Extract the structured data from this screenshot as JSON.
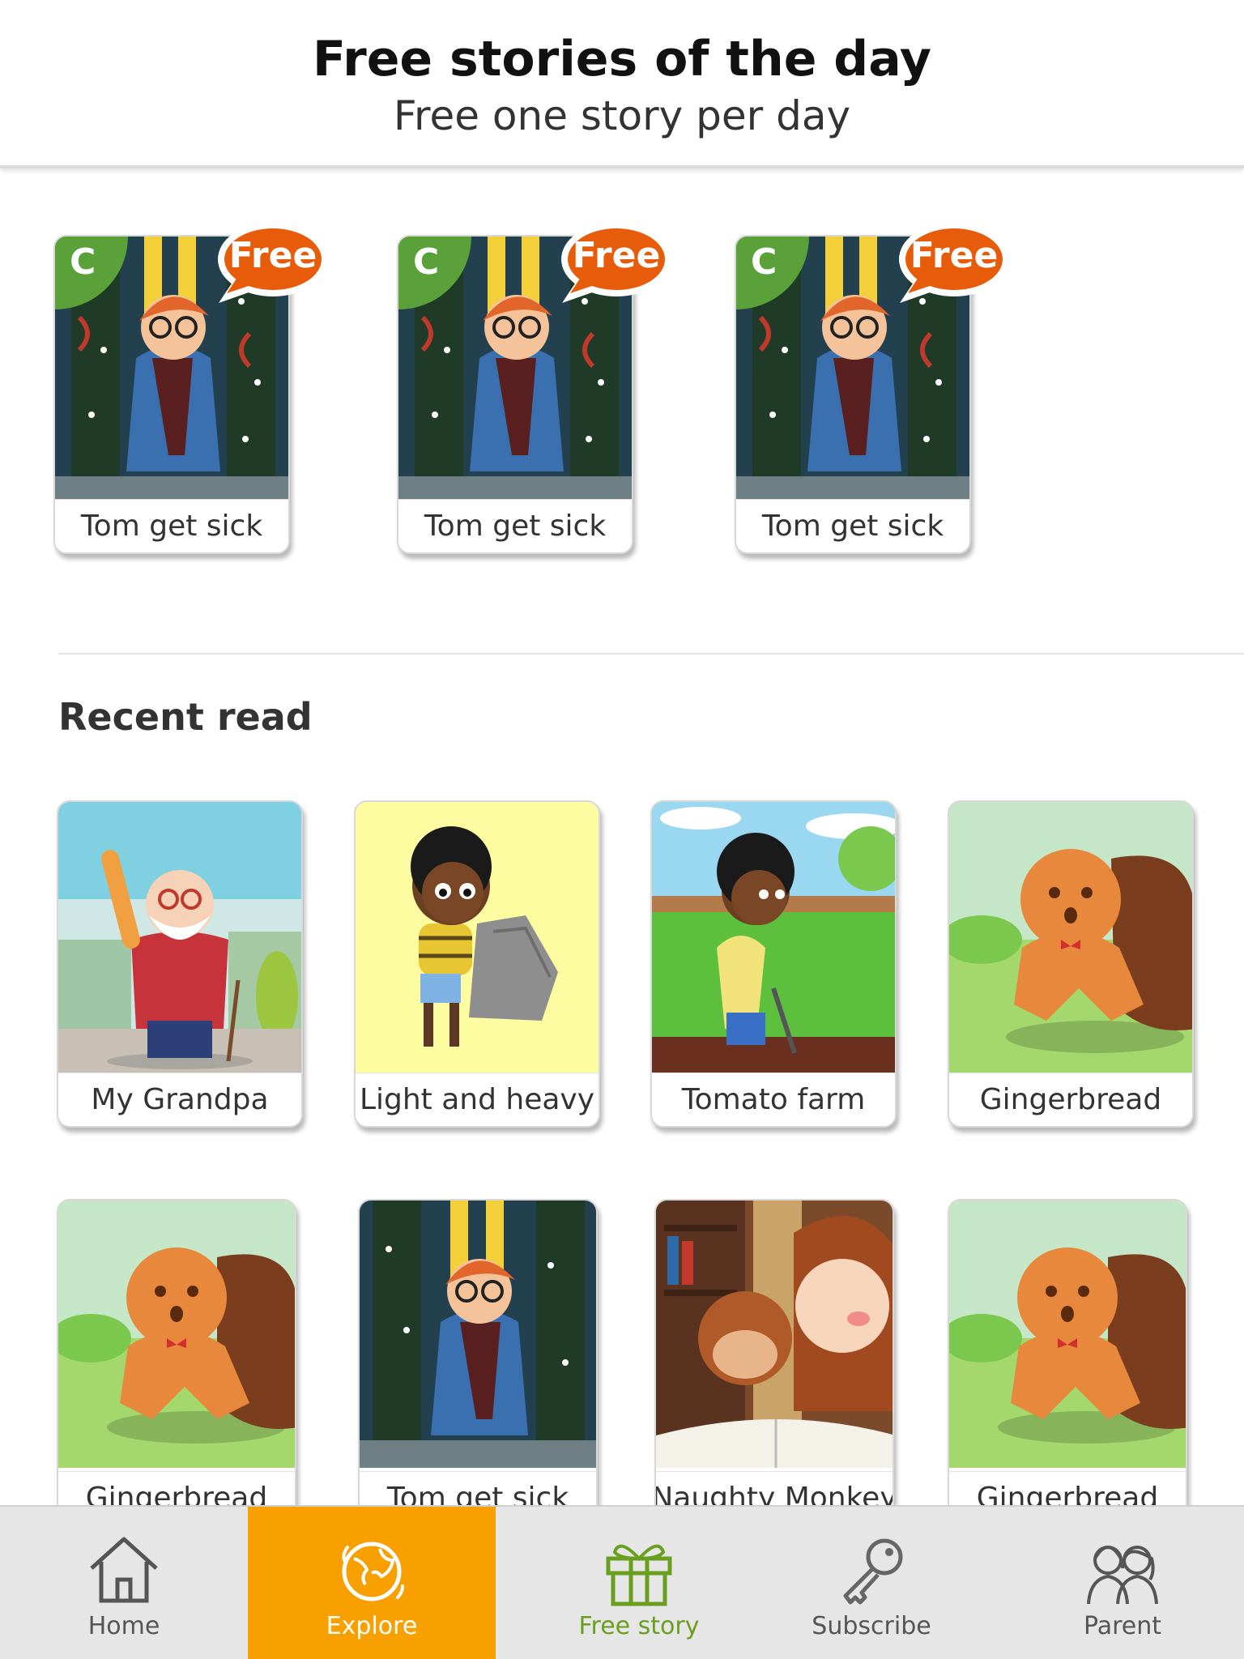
{
  "header": {
    "title": "Free stories of the day",
    "subtitle": "Free one story per day"
  },
  "free_stories": [
    {
      "title": "Tom get sick",
      "level": "C",
      "badge": "Free",
      "art": "tom"
    },
    {
      "title": "Tom get sick",
      "level": "C",
      "badge": "Free",
      "art": "tom"
    },
    {
      "title": "Tom get sick",
      "level": "C",
      "badge": "Free",
      "art": "tom"
    }
  ],
  "recent": {
    "heading": "Recent read",
    "items": [
      {
        "title": "My Grandpa",
        "art": "grandpa"
      },
      {
        "title": "Light and heavy",
        "art": "rock"
      },
      {
        "title": "Tomato farm",
        "art": "farm"
      },
      {
        "title": "Gingerbread",
        "art": "ginger"
      },
      {
        "title": "Gingerbread",
        "art": "ginger"
      },
      {
        "title": "Tom get sick",
        "art": "tom"
      },
      {
        "title": "Naughty Monkey",
        "art": "monkey"
      },
      {
        "title": "Gingerbread",
        "art": "ginger"
      }
    ]
  },
  "tabbar": {
    "active": "explore",
    "tabs": [
      {
        "id": "home",
        "label": "Home",
        "icon": "house-icon"
      },
      {
        "id": "explore",
        "label": "Explore",
        "icon": "globe-icon"
      },
      {
        "id": "free",
        "label": "Free story",
        "icon": "gift-icon"
      },
      {
        "id": "subscribe",
        "label": "Subscribe",
        "icon": "key-icon"
      },
      {
        "id": "parent",
        "label": "Parent",
        "icon": "parents-icon"
      }
    ]
  },
  "colors": {
    "accent_orange": "#f7a000",
    "free_badge": "#e65c0a",
    "level_green": "#5aa13a",
    "free_tab_green": "#6a9e1e"
  }
}
